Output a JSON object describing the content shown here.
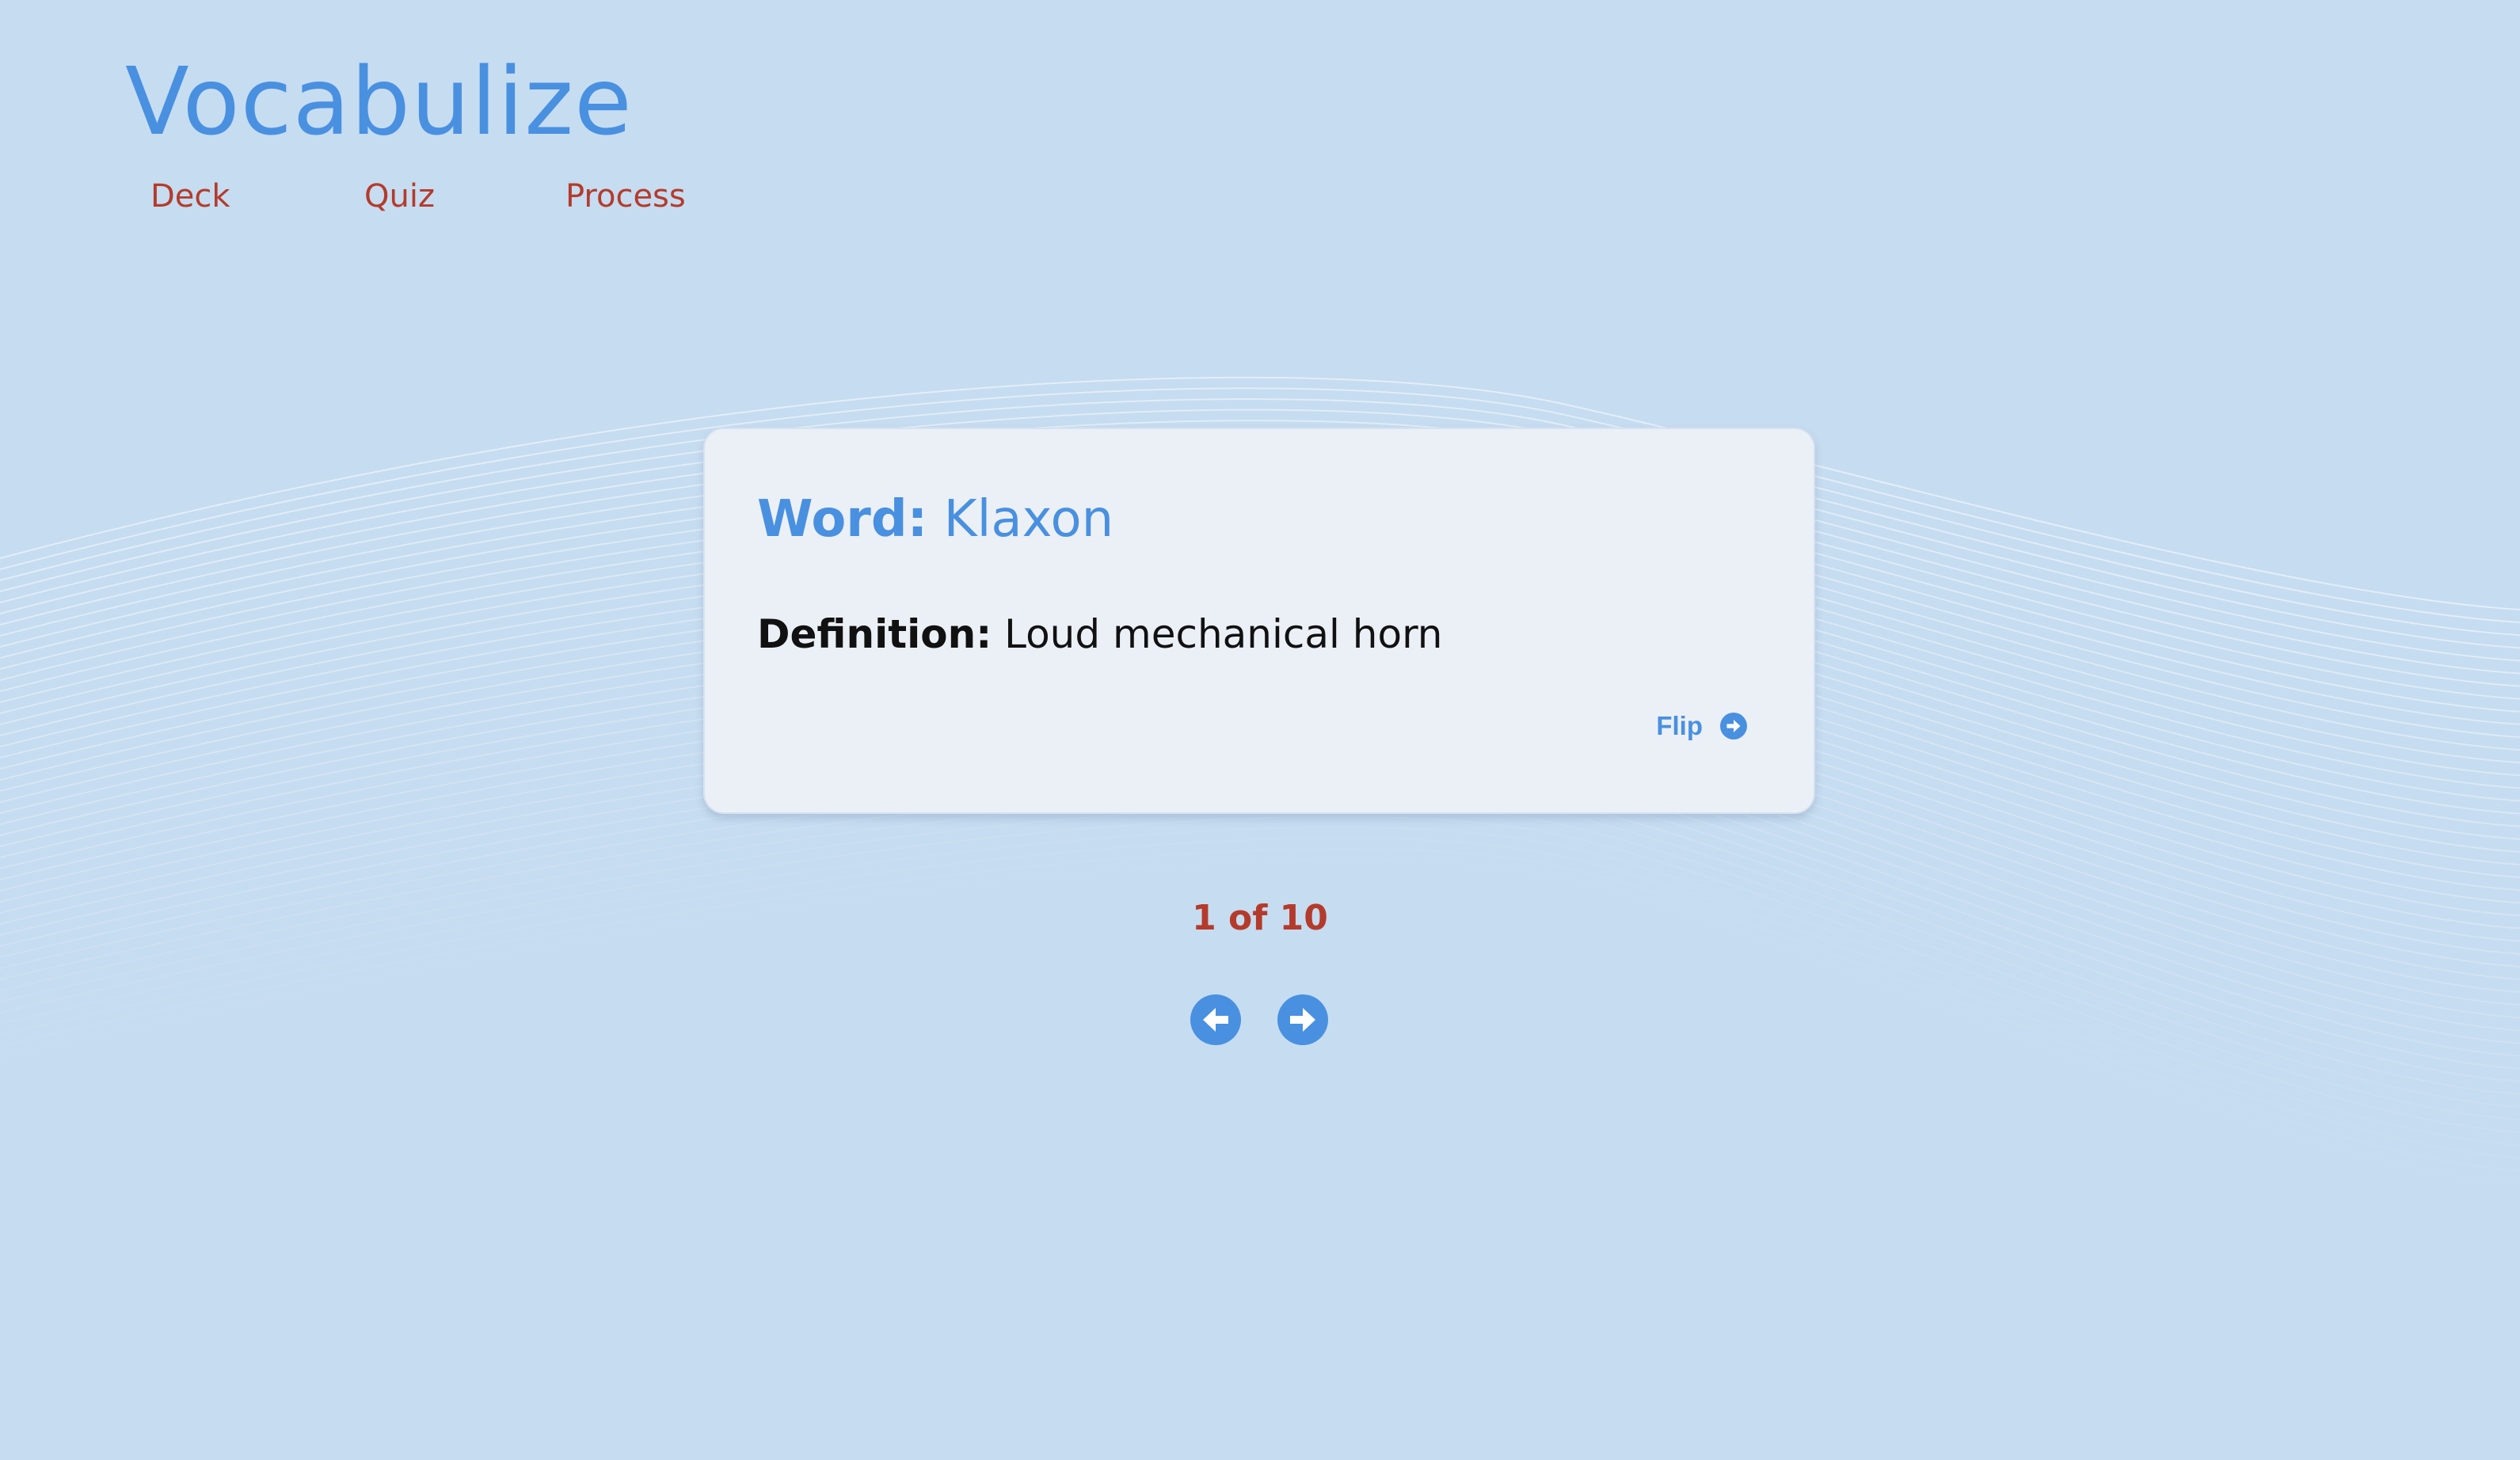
{
  "app": {
    "title": "Vocabulize"
  },
  "nav": {
    "items": [
      {
        "label": "Deck"
      },
      {
        "label": "Quiz"
      },
      {
        "label": "Process"
      }
    ]
  },
  "card": {
    "word_label": "Word:",
    "word": "Klaxon",
    "definition_label": "Definition:",
    "definition": "Loud mechanical horn",
    "flip_label": "Flip"
  },
  "pagination": {
    "counter": "1 of 10",
    "current": 1,
    "total": 10
  },
  "icons": {
    "flip": "arrow-circle-right-icon",
    "prev": "arrow-circle-left-icon",
    "next": "arrow-circle-right-icon"
  },
  "colors": {
    "background": "#c6dcf0",
    "accent_blue": "#4990e0",
    "accent_red": "#b43b2c",
    "card_background": "#ebf0f7"
  }
}
